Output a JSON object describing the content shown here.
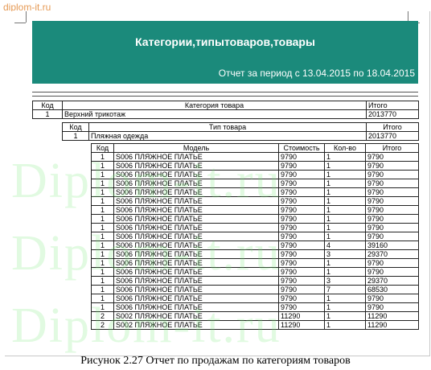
{
  "site": {
    "url": "diplom-it.ru",
    "watermark": "Diplom-it.ru"
  },
  "report": {
    "title": "Категории,типытоваров,товары",
    "period": "Отчет за период с 13.04.2015 по 18.04.2015"
  },
  "category_table": {
    "headers": [
      "Код",
      "Категория товара",
      "Итого"
    ],
    "row": [
      "1",
      "Верхний трикотаж",
      "2013770"
    ]
  },
  "type_table": {
    "headers": [
      "Код",
      "Тип товара",
      "Итого"
    ],
    "row": [
      "1",
      "Пляжная одежда",
      "2013770"
    ]
  },
  "items_table": {
    "headers": [
      "Код",
      "Модель",
      "Стоимость",
      "Кол-во",
      "Итого"
    ],
    "rows": [
      [
        "1",
        "S006  ПЛЯЖНОЕ  ПЛАТЬЕ",
        "9790",
        "1",
        "9790"
      ],
      [
        "1",
        "S006  ПЛЯЖНОЕ  ПЛАТЬЕ",
        "9790",
        "1",
        "9790"
      ],
      [
        "1",
        "S006  ПЛЯЖНОЕ  ПЛАТЬЕ",
        "9790",
        "1",
        "9790"
      ],
      [
        "1",
        "S006  ПЛЯЖНОЕ  ПЛАТЬЕ",
        "9790",
        "1",
        "9790"
      ],
      [
        "1",
        "S006  ПЛЯЖНОЕ  ПЛАТЬЕ",
        "9790",
        "1",
        "9790"
      ],
      [
        "1",
        "S006  ПЛЯЖНОЕ  ПЛАТЬЕ",
        "9790",
        "1",
        "9790"
      ],
      [
        "1",
        "S006  ПЛЯЖНОЕ  ПЛАТЬЕ",
        "9790",
        "1",
        "9790"
      ],
      [
        "1",
        "S006  ПЛЯЖНОЕ  ПЛАТЬЕ",
        "9790",
        "1",
        "9790"
      ],
      [
        "1",
        "S006  ПЛЯЖНОЕ  ПЛАТЬЕ",
        "9790",
        "1",
        "9790"
      ],
      [
        "1",
        "S006  ПЛЯЖНОЕ  ПЛАТЬЕ",
        "9790",
        "1",
        "9790"
      ],
      [
        "1",
        "S006  ПЛЯЖНОЕ  ПЛАТЬЕ",
        "9790",
        "4",
        "39160"
      ],
      [
        "1",
        "S006  ПЛЯЖНОЕ  ПЛАТЬЕ",
        "9790",
        "3",
        "29370"
      ],
      [
        "1",
        "S006  ПЛЯЖНОЕ  ПЛАТЬЕ",
        "9790",
        "1",
        "9790"
      ],
      [
        "1",
        "S006  ПЛЯЖНОЕ  ПЛАТЬЕ",
        "9790",
        "1",
        "9790"
      ],
      [
        "1",
        "S006  ПЛЯЖНОЕ  ПЛАТЬЕ",
        "9790",
        "3",
        "29370"
      ],
      [
        "1",
        "S006  ПЛЯЖНОЕ  ПЛАТЬЕ",
        "9790",
        "7",
        "68530"
      ],
      [
        "1",
        "S006  ПЛЯЖНОЕ  ПЛАТЬЕ",
        "9790",
        "1",
        "9790"
      ],
      [
        "1",
        "S006  ПЛЯЖНОЕ  ПЛАТЬЕ",
        "9790",
        "1",
        "9790"
      ],
      [
        "2",
        "S002  ПЛЯЖНОЕ  ПЛАТЬЕ",
        "11290",
        "1",
        "11290"
      ],
      [
        "2",
        "S002  ПЛЯЖНОЕ  ПЛАТЬЕ",
        "11290",
        "1",
        "11290"
      ]
    ]
  },
  "caption": "Рисунок 2.27 Отчет по продажам по категориям товаров"
}
